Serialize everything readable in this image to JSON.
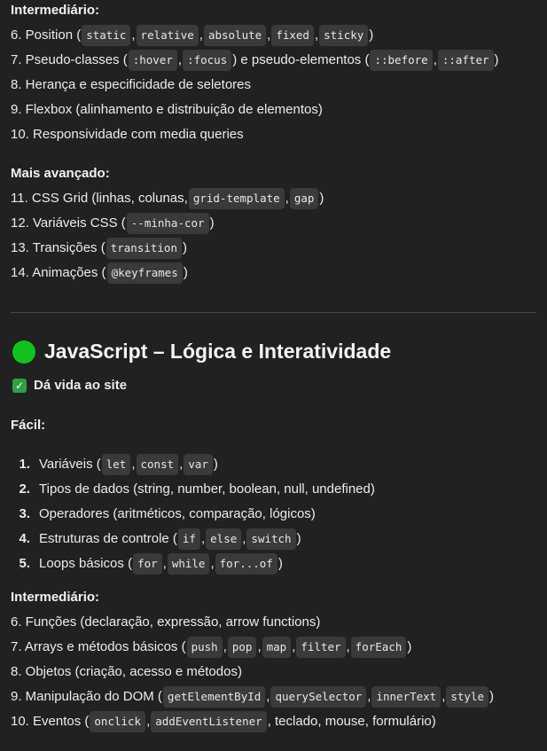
{
  "css_intermediate": {
    "heading": "Intermediário:",
    "items": [
      {
        "text": "6. Position (",
        "codes": [
          "static",
          "relative",
          "absolute",
          "fixed",
          "sticky"
        ],
        "after": ")"
      },
      {
        "text": "7. Pseudo-classes (",
        "codes": [
          ":hover",
          ":focus"
        ],
        "middle": ") e pseudo-elementos (",
        "codes2": [
          "::before",
          "::after"
        ],
        "after": ")"
      },
      {
        "text": "8. Herança e especificidade de seletores"
      },
      {
        "text": "9. Flexbox (alinhamento e distribuição de elementos)"
      },
      {
        "text": "10. Responsividade com media queries"
      }
    ]
  },
  "css_advanced": {
    "heading": "Mais avançado:",
    "items": [
      {
        "text": "11. CSS Grid (linhas, colunas, ",
        "codes": [
          "grid-template",
          "gap"
        ],
        "after": ")"
      },
      {
        "text": "12. Variáveis CSS (",
        "codes": [
          "--minha-cor"
        ],
        "after": ")"
      },
      {
        "text": "13. Transições (",
        "codes": [
          "transition"
        ],
        "after": ")"
      },
      {
        "text": "14. Animações (",
        "codes": [
          "@keyframes"
        ],
        "after": ")"
      }
    ]
  },
  "js_section": {
    "title": "JavaScript – Lógica e Interatividade",
    "subtitle": "Dá vida ao site",
    "easy_heading": "Fácil:",
    "easy_items": [
      {
        "num": "1.",
        "text": "Variáveis (",
        "codes": [
          "let",
          "const",
          "var"
        ],
        "after": ")"
      },
      {
        "num": "2.",
        "text": "Tipos de dados (string, number, boolean, null, undefined)"
      },
      {
        "num": "3.",
        "text": "Operadores (aritméticos, comparação, lógicos)"
      },
      {
        "num": "4.",
        "text": "Estruturas de controle (",
        "codes": [
          "if",
          "else",
          "switch"
        ],
        "after": ")"
      },
      {
        "num": "5.",
        "text": "Loops básicos (",
        "codes": [
          "for",
          "while",
          "for...of"
        ],
        "after": ")"
      }
    ],
    "intermediate_heading": "Intermediário:",
    "intermediate_items": [
      {
        "text": "6. Funções (declaração, expressão, arrow functions)"
      },
      {
        "text": "7. Arrays e métodos básicos (",
        "codes": [
          "push",
          "pop",
          "map",
          "filter",
          "forEach"
        ],
        "after": ")"
      },
      {
        "text": "8. Objetos (criação, acesso e métodos)"
      },
      {
        "text": "9. Manipulação do DOM (",
        "codes": [
          "getElementById",
          "querySelector",
          "innerText",
          "style"
        ],
        "after": ")"
      },
      {
        "text": "10. Eventos (",
        "codes": [
          "onclick",
          "addEventListener"
        ],
        "after": ", teclado, mouse, formulário)"
      }
    ]
  }
}
